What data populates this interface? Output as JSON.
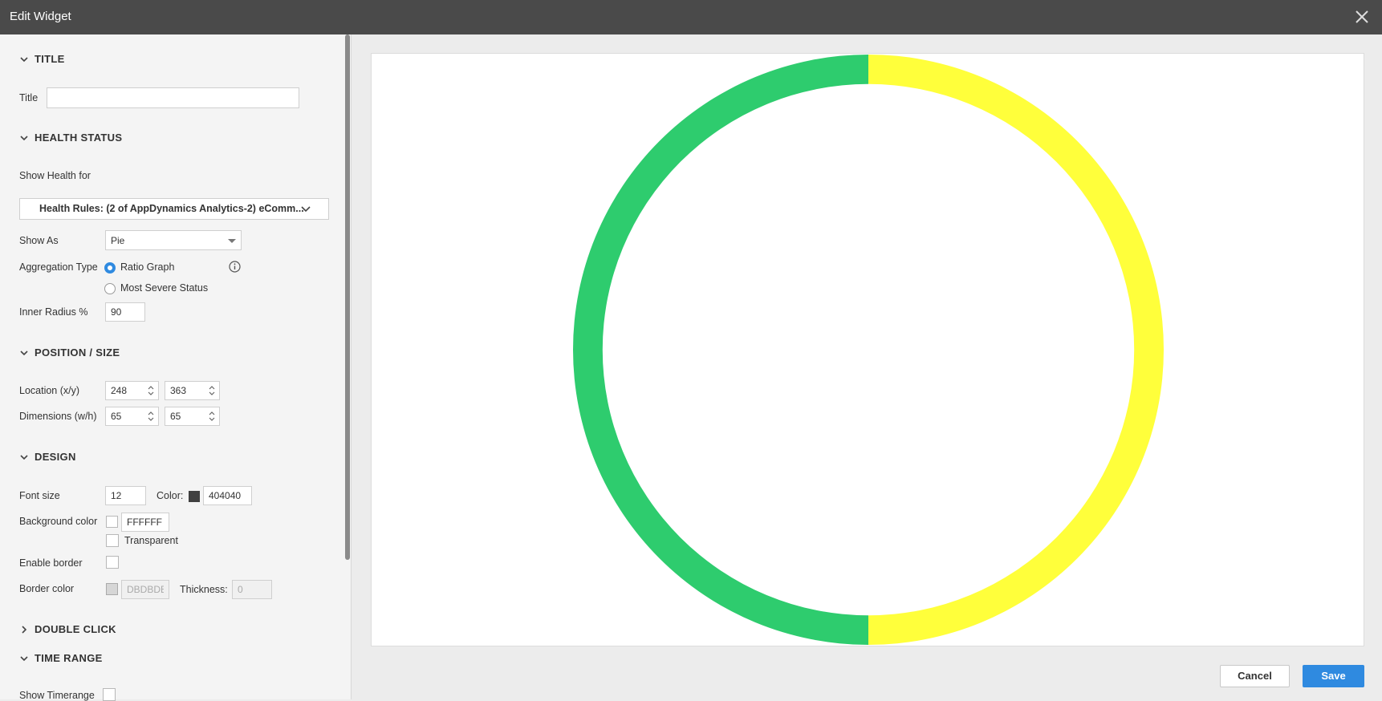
{
  "window": {
    "title": "Edit Widget"
  },
  "sections": {
    "title": "TITLE",
    "health_status": "HEALTH STATUS",
    "position_size": "POSITION / SIZE",
    "design": "DESIGN",
    "double_click": "DOUBLE CLICK",
    "time_range": "TIME RANGE"
  },
  "title_section": {
    "label": "Title",
    "value": ""
  },
  "health": {
    "show_health_for_label": "Show Health for",
    "health_rules_value": "Health Rules: (2 of AppDynamics Analytics-2) eComm...",
    "show_as_label": "Show As",
    "show_as_value": "Pie",
    "aggregation_label": "Aggregation Type",
    "aggregation_options": [
      "Ratio Graph",
      "Most Severe Status"
    ],
    "aggregation_selected": "Ratio Graph",
    "inner_radius_label": "Inner Radius %",
    "inner_radius_value": "90"
  },
  "position": {
    "location_label": "Location (x/y)",
    "location_x": "248",
    "location_y": "363",
    "dimensions_label": "Dimensions (w/h)",
    "dimensions_w": "65",
    "dimensions_h": "65"
  },
  "design": {
    "font_size_label": "Font size",
    "font_size_value": "12",
    "color_label": "Color:",
    "color_value": "404040",
    "bg_color_label": "Background color",
    "bg_color_value": "FFFFFF",
    "transparent_label": "Transparent",
    "enable_border_label": "Enable border",
    "border_color_label": "Border color",
    "border_color_value": "DBDBDB",
    "thickness_label": "Thickness:",
    "thickness_value": "0"
  },
  "time_range": {
    "show_timerange_label": "Show Timerange"
  },
  "colors": {
    "text_color": "#404040",
    "healthy": "#2ecc6e",
    "warning": "#ffff3b",
    "accent": "#2f8ae0"
  },
  "chart_data": {
    "type": "pie",
    "inner_radius_pct": 90,
    "slices": [
      {
        "value": 1,
        "color": "#ffff3b"
      },
      {
        "value": 1,
        "color": "#2ecc6e"
      }
    ]
  },
  "footer": {
    "cancel_label": "Cancel",
    "save_label": "Save"
  }
}
